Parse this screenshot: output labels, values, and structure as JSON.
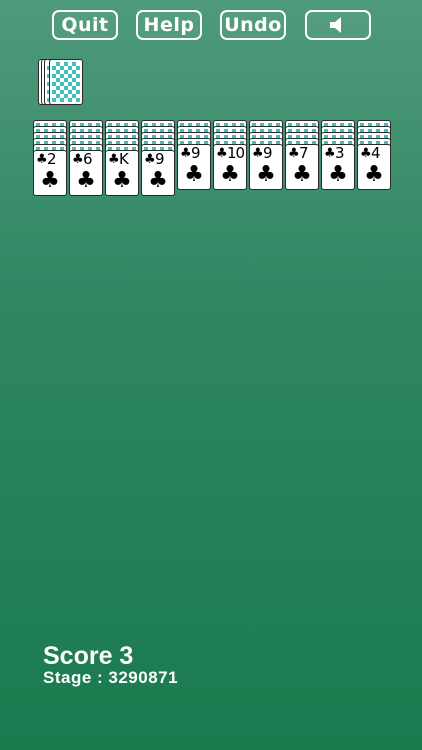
{
  "toolbar": {
    "quit_label": "Quit",
    "help_label": "Help",
    "undo_label": "Undo",
    "sound_icon": "speaker-icon"
  },
  "stock": {
    "cards_visible": 4
  },
  "tableau": {
    "columns": [
      {
        "rank": "2",
        "suit": "♣",
        "hidden_cards": 5
      },
      {
        "rank": "6",
        "suit": "♣",
        "hidden_cards": 5
      },
      {
        "rank": "K",
        "suit": "♣",
        "hidden_cards": 5
      },
      {
        "rank": "9",
        "suit": "♣",
        "hidden_cards": 5
      },
      {
        "rank": "9",
        "suit": "♣",
        "hidden_cards": 4
      },
      {
        "rank": "10",
        "suit": "♣",
        "hidden_cards": 4
      },
      {
        "rank": "9",
        "suit": "♣",
        "hidden_cards": 4
      },
      {
        "rank": "7",
        "suit": "♣",
        "hidden_cards": 4
      },
      {
        "rank": "3",
        "suit": "♣",
        "hidden_cards": 4
      },
      {
        "rank": "4",
        "suit": "♣",
        "hidden_cards": 4
      }
    ]
  },
  "status": {
    "score_text": "Score 3",
    "stage_text": "Stage : 3290871"
  },
  "colors": {
    "felt_top": "#4f9a7c",
    "felt_bottom": "#1a7a4e",
    "card_back": "#45bfbb"
  }
}
